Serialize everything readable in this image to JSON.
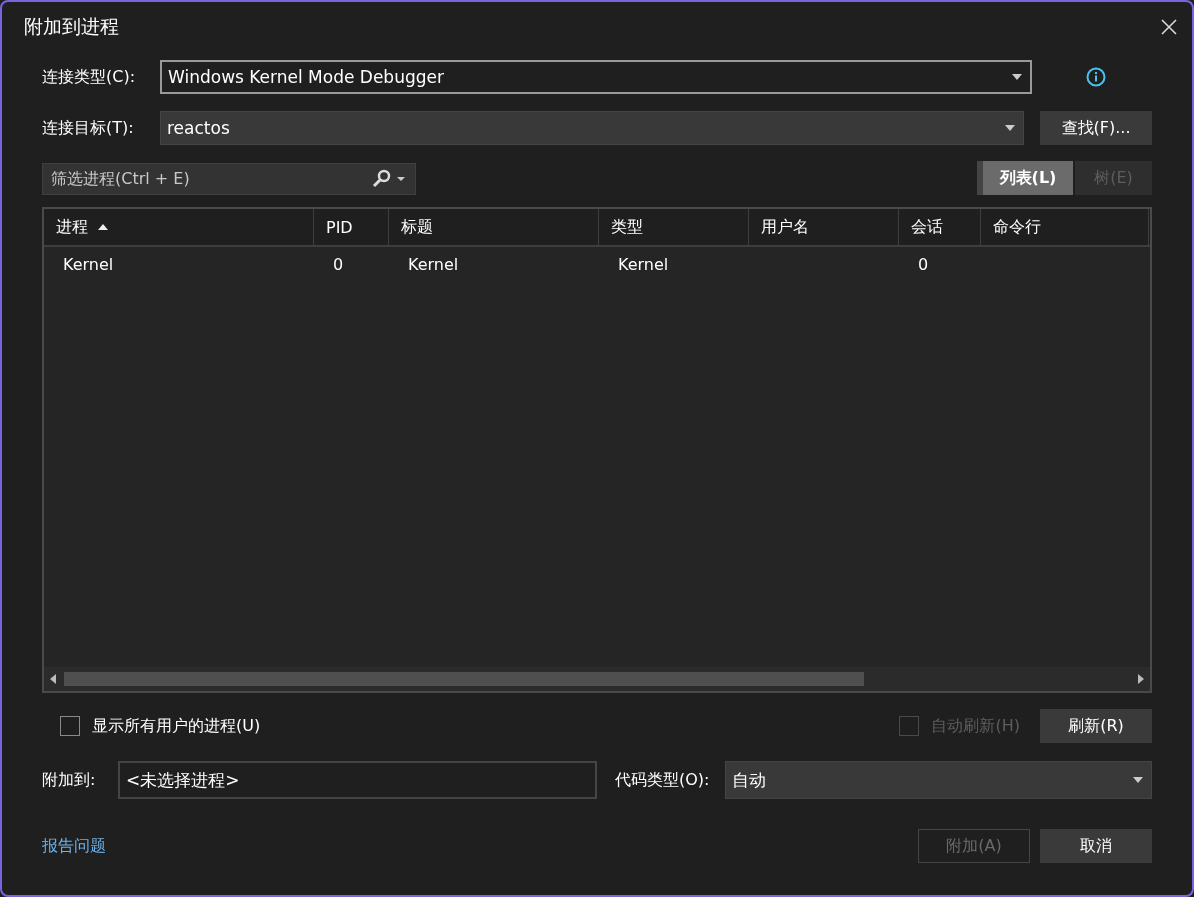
{
  "window": {
    "title": "附加到进程"
  },
  "connection_type": {
    "label": "连接类型(C):",
    "value": "Windows Kernel Mode Debugger"
  },
  "connection_target": {
    "label": "连接目标(T):",
    "value": "reactos",
    "find_button": "查找(F)..."
  },
  "filter": {
    "placeholder": "筛选进程(Ctrl + E)"
  },
  "view_toggle": [
    {
      "label": "列表(L)",
      "selected": true
    },
    {
      "label": "树(E)",
      "selected": false
    }
  ],
  "table": {
    "columns": [
      {
        "label": "进程",
        "sorted": true
      },
      {
        "label": "PID",
        "sorted": false
      },
      {
        "label": "标题",
        "sorted": false
      },
      {
        "label": "类型",
        "sorted": false
      },
      {
        "label": "用户名",
        "sorted": false
      },
      {
        "label": "会话",
        "sorted": false
      },
      {
        "label": "命令行",
        "sorted": false
      }
    ],
    "rows": [
      [
        "Kernel",
        "0",
        "Kernel",
        "Kernel",
        "",
        "0",
        ""
      ]
    ]
  },
  "show_all_users": {
    "label": "显示所有用户的进程(U)",
    "checked": false
  },
  "auto_refresh": {
    "label": "自动刷新(H)",
    "checked": false,
    "disabled": true
  },
  "refresh_button": "刷新(R)",
  "attach_to": {
    "label": "附加到:",
    "value": "<未选择进程>"
  },
  "code_type": {
    "label": "代码类型(O):",
    "value": "自动"
  },
  "report_link": "报告问题",
  "buttons": [
    {
      "label": "附加(A)",
      "disabled": true
    },
    {
      "label": "取消",
      "disabled": false
    }
  ]
}
